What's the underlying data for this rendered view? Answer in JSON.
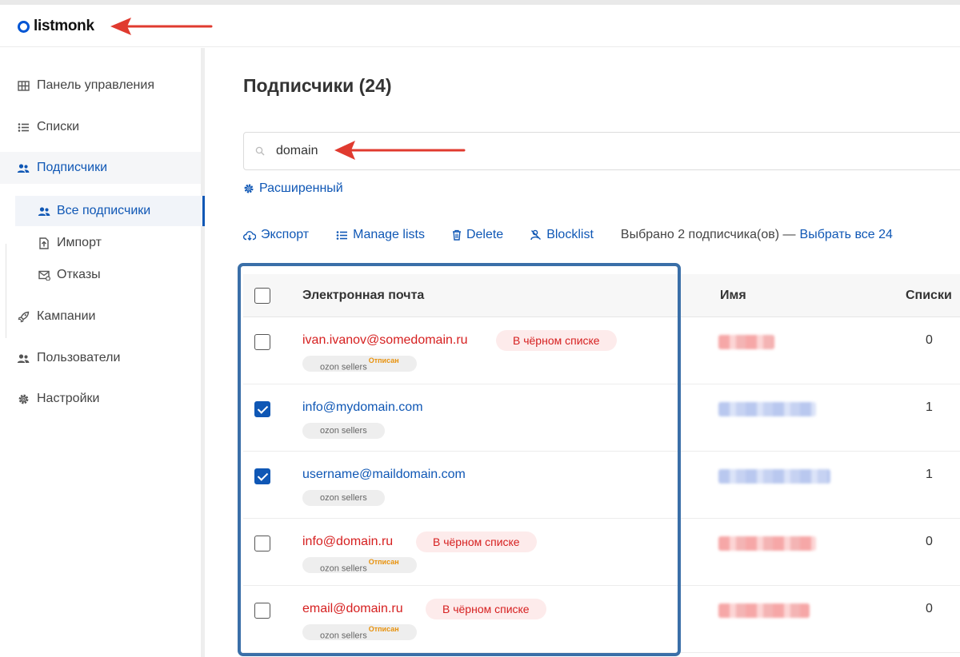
{
  "app": {
    "logo_text": "listmonk"
  },
  "sidebar": {
    "items": [
      {
        "label": "Панель управления",
        "icon": "dashboard-icon"
      },
      {
        "label": "Списки",
        "icon": "list-icon"
      },
      {
        "label": "Подписчики",
        "icon": "users-icon",
        "active": true
      },
      {
        "label": "Кампании",
        "icon": "rocket-icon"
      },
      {
        "label": "Пользователи",
        "icon": "users-icon"
      },
      {
        "label": "Настройки",
        "icon": "gear-icon"
      }
    ],
    "subitems": [
      {
        "label": "Все подписчики",
        "icon": "users-icon",
        "active": true
      },
      {
        "label": "Импорт",
        "icon": "import-icon"
      },
      {
        "label": "Отказы",
        "icon": "bounce-icon"
      }
    ]
  },
  "main": {
    "title": "Подписчики (24)",
    "search": {
      "value": "domain",
      "placeholder": ""
    },
    "advanced_label": "Расширенный",
    "toolbar": {
      "export_label": "Экспорт",
      "manage_lists_label": "Manage lists",
      "delete_label": "Delete",
      "blocklist_label": "Blocklist",
      "selected_text": "Выбрано 2 подписчика(ов) —",
      "select_all_label": "Выбрать все 24"
    },
    "table": {
      "columns": [
        "Электронная почта",
        "Имя",
        "Списки"
      ],
      "rows": [
        {
          "email": "ivan.ivanov@somedomain.ru",
          "status": "blocklisted",
          "status_label": "В чёрном списке",
          "list_tag": "ozon sellers",
          "list_status": "Отписан",
          "checked": false,
          "lists": "0"
        },
        {
          "email": "info@mydomain.com",
          "status": "enabled",
          "status_label": "",
          "list_tag": "ozon sellers",
          "list_status": "",
          "checked": true,
          "lists": "1"
        },
        {
          "email": "username@maildomain.com",
          "status": "enabled",
          "status_label": "",
          "list_tag": "ozon sellers",
          "list_status": "",
          "checked": true,
          "lists": "1"
        },
        {
          "email": "info@domain.ru",
          "status": "blocklisted",
          "status_label": "В чёрном списке",
          "list_tag": "ozon sellers",
          "list_status": "Отписан",
          "checked": false,
          "lists": "0"
        },
        {
          "email": "email@domain.ru",
          "status": "blocklisted",
          "status_label": "В чёрном списке",
          "list_tag": "ozon sellers",
          "list_status": "Отписан",
          "checked": false,
          "lists": "0"
        }
      ]
    }
  },
  "colors": {
    "accent": "#0f57b5",
    "danger": "#d62020",
    "annotation_arrow": "#e03a2f",
    "highlight_box": "#3a6fa8"
  }
}
